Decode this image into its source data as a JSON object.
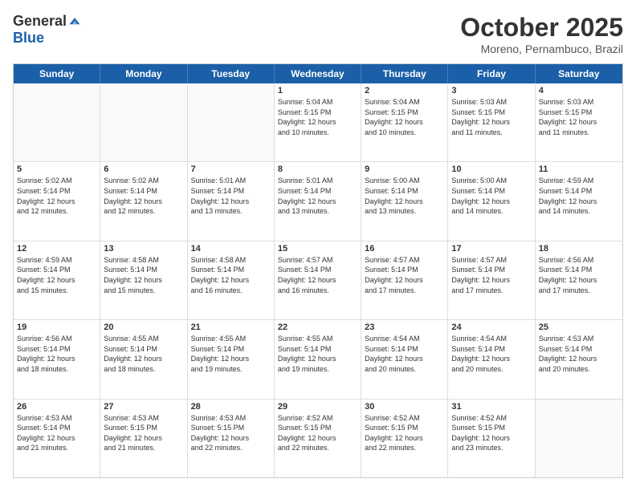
{
  "logo": {
    "general": "General",
    "blue": "Blue"
  },
  "header": {
    "month": "October 2025",
    "location": "Moreno, Pernambuco, Brazil"
  },
  "days": [
    "Sunday",
    "Monday",
    "Tuesday",
    "Wednesday",
    "Thursday",
    "Friday",
    "Saturday"
  ],
  "weeks": [
    [
      {
        "day": "",
        "info": ""
      },
      {
        "day": "",
        "info": ""
      },
      {
        "day": "",
        "info": ""
      },
      {
        "day": "1",
        "info": "Sunrise: 5:04 AM\nSunset: 5:15 PM\nDaylight: 12 hours\nand 10 minutes."
      },
      {
        "day": "2",
        "info": "Sunrise: 5:04 AM\nSunset: 5:15 PM\nDaylight: 12 hours\nand 10 minutes."
      },
      {
        "day": "3",
        "info": "Sunrise: 5:03 AM\nSunset: 5:15 PM\nDaylight: 12 hours\nand 11 minutes."
      },
      {
        "day": "4",
        "info": "Sunrise: 5:03 AM\nSunset: 5:15 PM\nDaylight: 12 hours\nand 11 minutes."
      }
    ],
    [
      {
        "day": "5",
        "info": "Sunrise: 5:02 AM\nSunset: 5:14 PM\nDaylight: 12 hours\nand 12 minutes."
      },
      {
        "day": "6",
        "info": "Sunrise: 5:02 AM\nSunset: 5:14 PM\nDaylight: 12 hours\nand 12 minutes."
      },
      {
        "day": "7",
        "info": "Sunrise: 5:01 AM\nSunset: 5:14 PM\nDaylight: 12 hours\nand 13 minutes."
      },
      {
        "day": "8",
        "info": "Sunrise: 5:01 AM\nSunset: 5:14 PM\nDaylight: 12 hours\nand 13 minutes."
      },
      {
        "day": "9",
        "info": "Sunrise: 5:00 AM\nSunset: 5:14 PM\nDaylight: 12 hours\nand 13 minutes."
      },
      {
        "day": "10",
        "info": "Sunrise: 5:00 AM\nSunset: 5:14 PM\nDaylight: 12 hours\nand 14 minutes."
      },
      {
        "day": "11",
        "info": "Sunrise: 4:59 AM\nSunset: 5:14 PM\nDaylight: 12 hours\nand 14 minutes."
      }
    ],
    [
      {
        "day": "12",
        "info": "Sunrise: 4:59 AM\nSunset: 5:14 PM\nDaylight: 12 hours\nand 15 minutes."
      },
      {
        "day": "13",
        "info": "Sunrise: 4:58 AM\nSunset: 5:14 PM\nDaylight: 12 hours\nand 15 minutes."
      },
      {
        "day": "14",
        "info": "Sunrise: 4:58 AM\nSunset: 5:14 PM\nDaylight: 12 hours\nand 16 minutes."
      },
      {
        "day": "15",
        "info": "Sunrise: 4:57 AM\nSunset: 5:14 PM\nDaylight: 12 hours\nand 16 minutes."
      },
      {
        "day": "16",
        "info": "Sunrise: 4:57 AM\nSunset: 5:14 PM\nDaylight: 12 hours\nand 17 minutes."
      },
      {
        "day": "17",
        "info": "Sunrise: 4:57 AM\nSunset: 5:14 PM\nDaylight: 12 hours\nand 17 minutes."
      },
      {
        "day": "18",
        "info": "Sunrise: 4:56 AM\nSunset: 5:14 PM\nDaylight: 12 hours\nand 17 minutes."
      }
    ],
    [
      {
        "day": "19",
        "info": "Sunrise: 4:56 AM\nSunset: 5:14 PM\nDaylight: 12 hours\nand 18 minutes."
      },
      {
        "day": "20",
        "info": "Sunrise: 4:55 AM\nSunset: 5:14 PM\nDaylight: 12 hours\nand 18 minutes."
      },
      {
        "day": "21",
        "info": "Sunrise: 4:55 AM\nSunset: 5:14 PM\nDaylight: 12 hours\nand 19 minutes."
      },
      {
        "day": "22",
        "info": "Sunrise: 4:55 AM\nSunset: 5:14 PM\nDaylight: 12 hours\nand 19 minutes."
      },
      {
        "day": "23",
        "info": "Sunrise: 4:54 AM\nSunset: 5:14 PM\nDaylight: 12 hours\nand 20 minutes."
      },
      {
        "day": "24",
        "info": "Sunrise: 4:54 AM\nSunset: 5:14 PM\nDaylight: 12 hours\nand 20 minutes."
      },
      {
        "day": "25",
        "info": "Sunrise: 4:53 AM\nSunset: 5:14 PM\nDaylight: 12 hours\nand 20 minutes."
      }
    ],
    [
      {
        "day": "26",
        "info": "Sunrise: 4:53 AM\nSunset: 5:14 PM\nDaylight: 12 hours\nand 21 minutes."
      },
      {
        "day": "27",
        "info": "Sunrise: 4:53 AM\nSunset: 5:15 PM\nDaylight: 12 hours\nand 21 minutes."
      },
      {
        "day": "28",
        "info": "Sunrise: 4:53 AM\nSunset: 5:15 PM\nDaylight: 12 hours\nand 22 minutes."
      },
      {
        "day": "29",
        "info": "Sunrise: 4:52 AM\nSunset: 5:15 PM\nDaylight: 12 hours\nand 22 minutes."
      },
      {
        "day": "30",
        "info": "Sunrise: 4:52 AM\nSunset: 5:15 PM\nDaylight: 12 hours\nand 22 minutes."
      },
      {
        "day": "31",
        "info": "Sunrise: 4:52 AM\nSunset: 5:15 PM\nDaylight: 12 hours\nand 23 minutes."
      },
      {
        "day": "",
        "info": ""
      }
    ]
  ]
}
